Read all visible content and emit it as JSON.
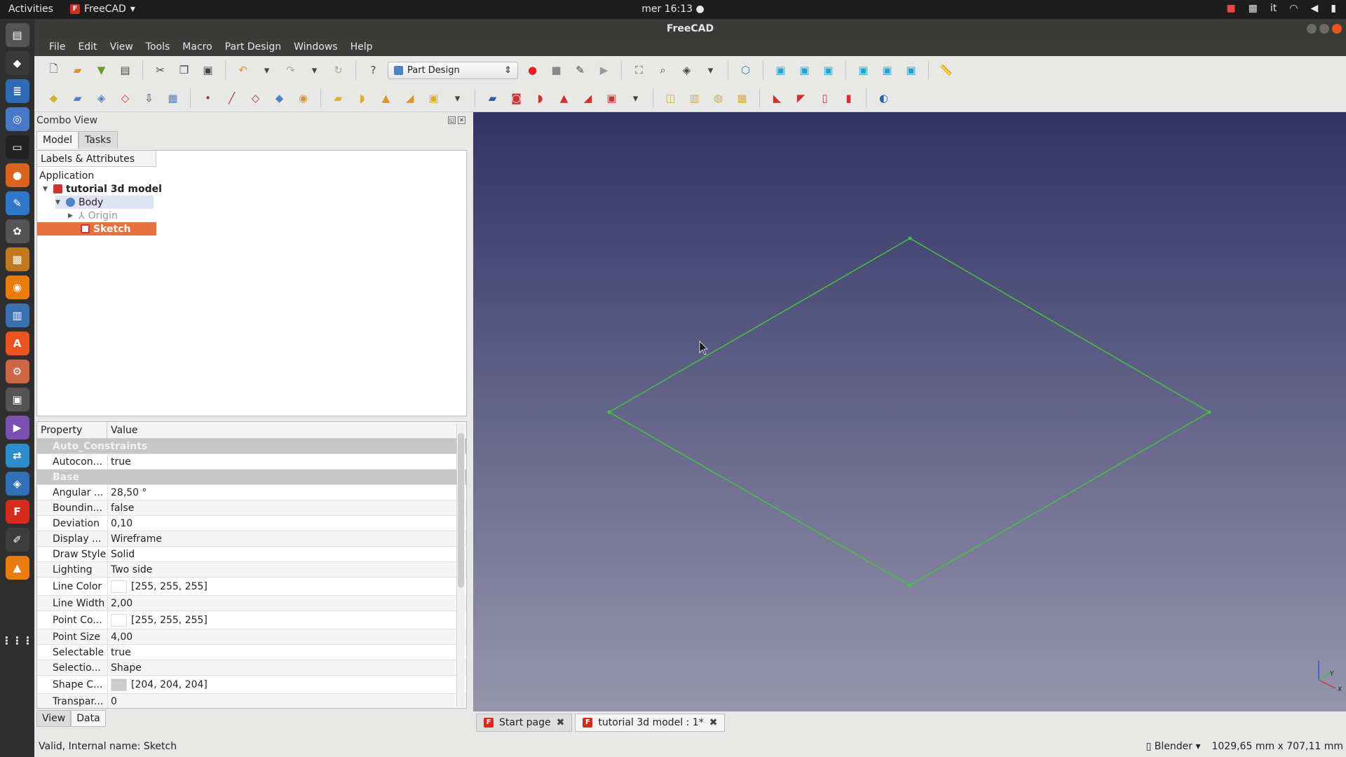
{
  "system": {
    "activities": "Activities",
    "app_name": "FreeCAD",
    "clock": "mer 16:13 ●",
    "lang": "it"
  },
  "window": {
    "title": "FreeCAD"
  },
  "menu": [
    "File",
    "Edit",
    "View",
    "Tools",
    "Macro",
    "Part Design",
    "Windows",
    "Help"
  ],
  "workbench": {
    "selected": "Part Design"
  },
  "combo_view": {
    "title": "Combo View",
    "tabs": [
      "Model",
      "Tasks"
    ],
    "tree": {
      "header": "Labels & Attributes",
      "root": "Application",
      "document": "tutorial 3d model",
      "body": "Body",
      "origin": "Origin",
      "sketch": "Sketch"
    },
    "properties": {
      "col_property": "Property",
      "col_value": "Value",
      "group_auto": "Auto_Constraints",
      "group_base": "Base",
      "rows": [
        {
          "key": "Autocon...",
          "value": "true"
        },
        {
          "key": "Angular ...",
          "value": "28,50 °"
        },
        {
          "key": "Boundin...",
          "value": "false"
        },
        {
          "key": "Deviation",
          "value": "0,10"
        },
        {
          "key": "Display ...",
          "value": "Wireframe"
        },
        {
          "key": "Draw Style",
          "value": "Solid"
        },
        {
          "key": "Lighting",
          "value": "Two side"
        },
        {
          "key": "Line Color",
          "value": "[255, 255, 255]",
          "swatch": "#ffffff"
        },
        {
          "key": "Line Width",
          "value": "2,00"
        },
        {
          "key": "Point Co...",
          "value": "[255, 255, 255]",
          "swatch": "#ffffff"
        },
        {
          "key": "Point Size",
          "value": "4,00"
        },
        {
          "key": "Selectable",
          "value": "true"
        },
        {
          "key": "Selectio...",
          "value": "Shape"
        },
        {
          "key": "Shape C...",
          "value": "[204, 204, 204]",
          "swatch": "#cccccc"
        },
        {
          "key": "Transpar...",
          "value": "0"
        }
      ]
    },
    "bottom_tabs": [
      "View",
      "Data"
    ]
  },
  "document_tabs": [
    {
      "label": "Start page"
    },
    {
      "label": "tutorial 3d model : 1*"
    }
  ],
  "status": {
    "message": "Valid, Internal name: Sketch",
    "navigation": "Blender",
    "dimensions": "1029,65 mm x 707,11 mm"
  },
  "colors": {
    "sketch_line": "#3ec63e",
    "selection": "#e8703f",
    "viewport_top": "#333366",
    "viewport_bottom": "#9795ad"
  }
}
